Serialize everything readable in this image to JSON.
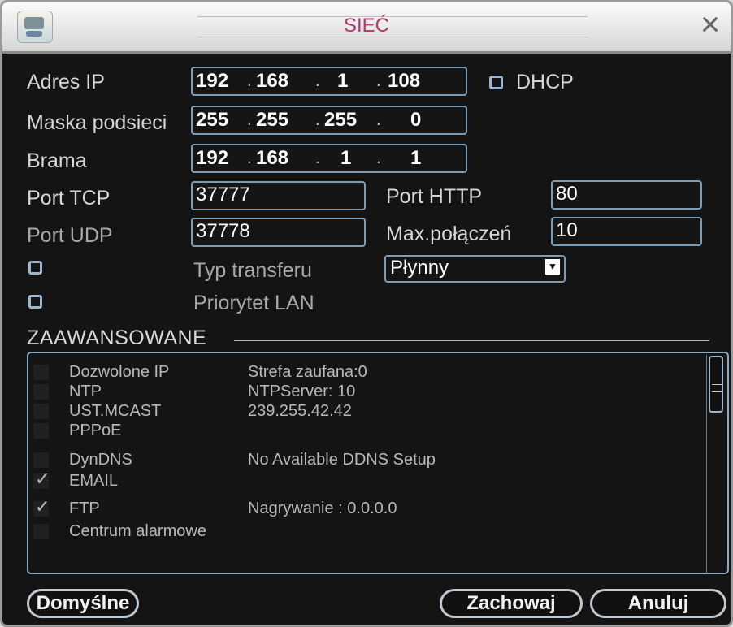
{
  "window": {
    "title": "SIEĆ",
    "close_icon": "close-icon"
  },
  "network": {
    "ip_label": "Adres IP",
    "ip": [
      "192",
      "168",
      "1",
      "108"
    ],
    "mask_label": "Maska podsieci",
    "mask": [
      "255",
      "255",
      "255",
      "0"
    ],
    "gateway_label": "Brama",
    "gateway": [
      "192",
      "168",
      "1",
      "1"
    ],
    "dhcp_label": "DHCP",
    "dhcp_checked": false,
    "tcp_port_label": "Port TCP",
    "tcp_port": "37777",
    "http_port_label": "Port HTTP",
    "http_port": "80",
    "udp_port_label": "Port UDP",
    "udp_port": "37778",
    "max_connections_label": "Max.połączeń",
    "max_connections": "10",
    "transfer_type_label": "Typ transferu",
    "transfer_type": "Płynny",
    "lan_priority_label": "Priorytet LAN"
  },
  "advanced": {
    "title": "ZAAWANSOWANE",
    "items": [
      {
        "name": "Dozwolone IP",
        "value": "Strefa zaufana:0",
        "checked": false
      },
      {
        "name": "NTP",
        "value": "NTPServer: 10",
        "checked": false
      },
      {
        "name": "UST.MCAST",
        "value": "239.255.42.42",
        "checked": false
      },
      {
        "name": "PPPoE",
        "value": "",
        "checked": false
      },
      {
        "name": "DynDNS",
        "value": "No Available DDNS Setup",
        "checked": false
      },
      {
        "name": "EMAIL",
        "value": "",
        "checked": true
      },
      {
        "name": "FTP",
        "value": "Nagrywanie : 0.0.0.0",
        "checked": true
      },
      {
        "name": "Centrum alarmowe",
        "value": "",
        "checked": false
      }
    ]
  },
  "buttons": {
    "default": "Domyślne",
    "save": "Zachowaj",
    "cancel": "Anuluj"
  },
  "colors": {
    "accent": "#b0386d",
    "field_border": "#7c9db8"
  }
}
